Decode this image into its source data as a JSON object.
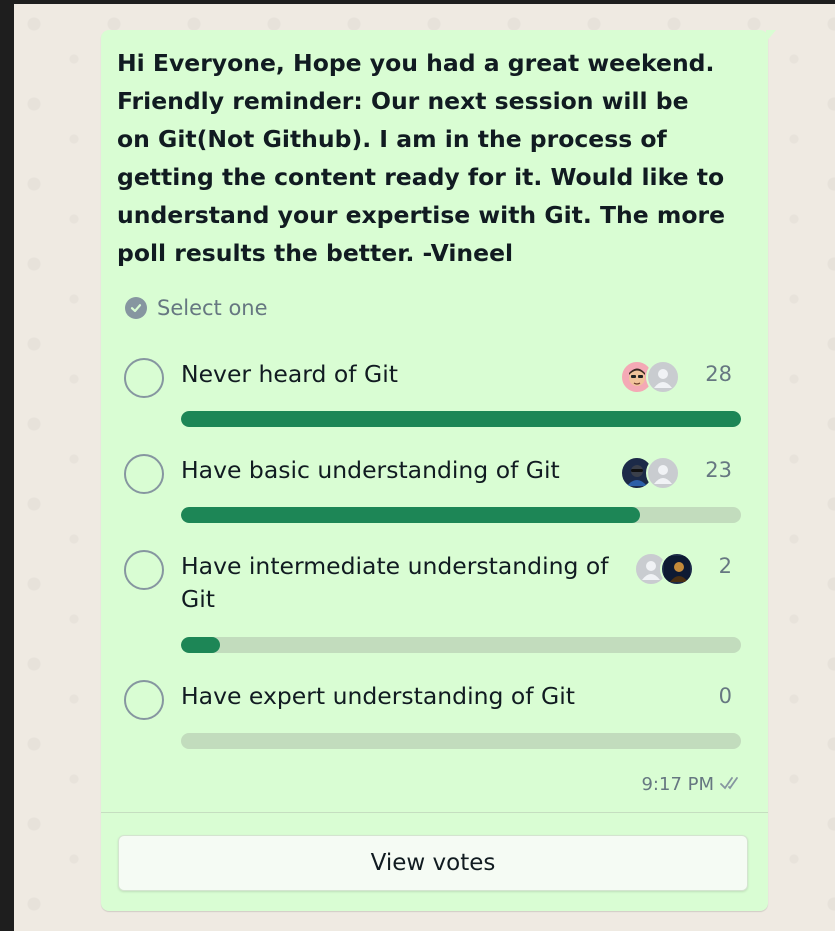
{
  "message": {
    "question": "Hi Everyone, Hope you had a great weekend. Friendly reminder: Our next session will be on Git(Not Github). I am in the process of getting the content ready for it. Would like to understand your expertise with Git. The more poll results the better. -Vineel",
    "select_hint": "Select one",
    "time": "9:17 PM",
    "status_icon": "double-check-icon"
  },
  "poll": {
    "options": [
      {
        "label": "Never heard of Git",
        "votes": "28",
        "fraction": 1.0,
        "voter_icons": [
          "memoji-avatar",
          "default-avatar"
        ]
      },
      {
        "label": "Have basic understanding of Git",
        "votes": "23",
        "fraction": 0.82,
        "voter_icons": [
          "photo-avatar",
          "default-avatar"
        ]
      },
      {
        "label": "Have intermediate understanding of Git",
        "votes": "2",
        "fraction": 0.07,
        "voter_icons": [
          "default-avatar",
          "photo-avatar"
        ]
      },
      {
        "label": "Have expert understanding of Git",
        "votes": "0",
        "fraction": 0.0,
        "voter_icons": []
      }
    ]
  },
  "actions": {
    "view_votes": "View votes"
  },
  "colors": {
    "bubble": "#d9fdd3",
    "bar_fill": "#1d8656",
    "bar_track": "#c2dcbd",
    "meta_text": "#667781"
  }
}
